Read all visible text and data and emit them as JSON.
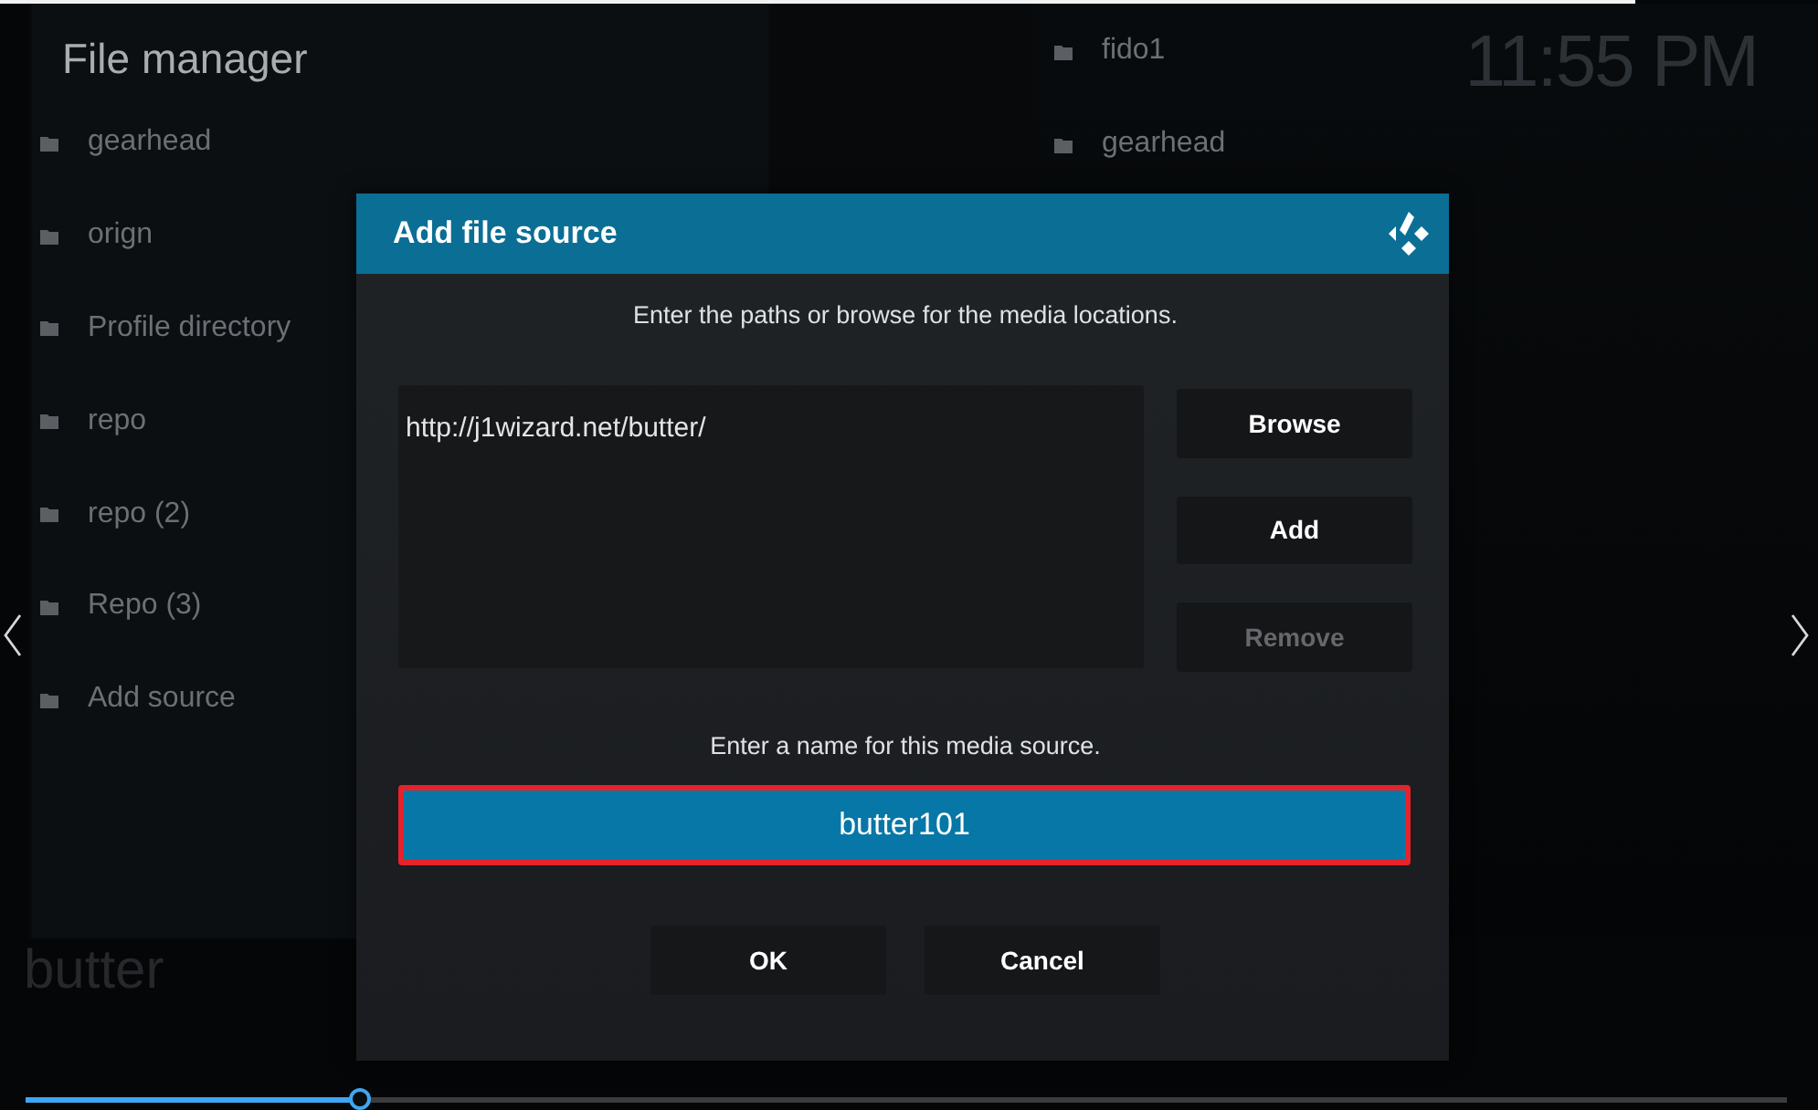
{
  "screen": {
    "title": "File manager",
    "clock": "11:55 PM",
    "footer_label": "butter"
  },
  "left_list": [
    {
      "label": "gearhead"
    },
    {
      "label": "orign"
    },
    {
      "label": "Profile directory"
    },
    {
      "label": "repo"
    },
    {
      "label": "repo (2)"
    },
    {
      "label": "Repo (3)"
    },
    {
      "label": "Add source"
    }
  ],
  "right_list": [
    {
      "label": "fido1"
    },
    {
      "label": "gearhead"
    }
  ],
  "dialog": {
    "title": "Add file source",
    "instruction": "Enter the paths or browse for the media locations.",
    "paths": [
      "http://j1wizard.net/butter/"
    ],
    "buttons": [
      {
        "label": "Browse",
        "disabled": false
      },
      {
        "label": "Add",
        "disabled": false
      },
      {
        "label": "Remove",
        "disabled": true
      }
    ],
    "name_prompt": "Enter a name for this media source.",
    "name_field": {
      "value": "butter101",
      "focused": true,
      "highlighted": true
    },
    "actions": [
      {
        "label": "OK"
      },
      {
        "label": "Cancel"
      }
    ]
  },
  "video_progress": {
    "level": 0.19
  }
}
